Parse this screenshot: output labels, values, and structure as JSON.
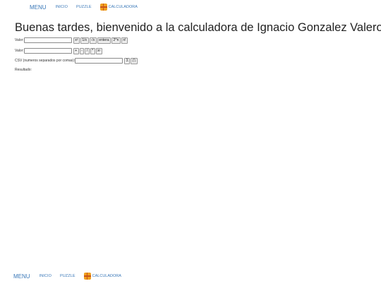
{
  "nav": {
    "menu": "MENU",
    "inicio": "INICIO",
    "puzzle": "PUZZLE",
    "calculadora": "CALCULADORA"
  },
  "title": "Buenas tardes, bienvenido a la calculadora de Ignacio Gonzalez Valero",
  "row1": {
    "label": "Valor:",
    "value": "",
    "buttons": [
      "x²",
      "1/x",
      "√x",
      "entera",
      "2^n",
      "n!"
    ]
  },
  "row2": {
    "label": "Valor:",
    "value": "",
    "buttons": [
      "+",
      "-",
      "/",
      "*",
      "xʸ"
    ]
  },
  "row3": {
    "label": "CSV (numeros separados por comas):",
    "value": "",
    "buttons": [
      "Σ",
      "∏"
    ]
  },
  "result": {
    "label": "Resultado:",
    "value": ""
  },
  "colors": {
    "link": "#3a78b8",
    "icon_orange": "#f0a020",
    "icon_dark": "#c8541a"
  }
}
